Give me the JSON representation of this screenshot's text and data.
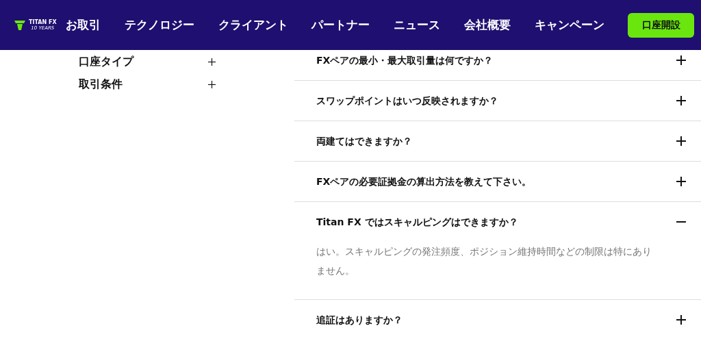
{
  "header": {
    "logo": {
      "name": "TITAN FX",
      "tagline": "10 YEARS"
    },
    "nav": [
      "お取引",
      "テクノロジー",
      "クライアント",
      "パートナー",
      "ニュース",
      "会社概要",
      "キャンペーン"
    ],
    "cta": "口座開設"
  },
  "sidebar": {
    "items": [
      {
        "label": "口座タイプ",
        "expanded": false
      },
      {
        "label": "取引条件",
        "expanded": false
      }
    ]
  },
  "faq": [
    {
      "question": "FXペアの最小・最大取引量は何ですか？",
      "expanded": false
    },
    {
      "question": "スワップポイントはいつ反映されますか？",
      "expanded": false
    },
    {
      "question": "両建てはできますか？",
      "expanded": false
    },
    {
      "question": "FXペアの必要証拠金の算出方法を教えて下さい。",
      "expanded": false
    },
    {
      "question": "Titan FX ではスキャルピングはできますか？",
      "expanded": true,
      "answer": "はい。スキャルピングの発注頻度、ポジション維持時間などの制限は特にありません。"
    },
    {
      "question": "追証はありますか？",
      "expanded": false
    }
  ]
}
